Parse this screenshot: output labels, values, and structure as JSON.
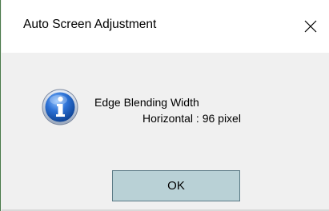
{
  "window": {
    "title": "Auto Screen Adjustment",
    "close_icon": "close-icon"
  },
  "message": {
    "icon": "info-icon",
    "line1": "Edge Blending Width",
    "line2": "Horizontal : 96 pixel"
  },
  "buttons": {
    "ok_label": "OK"
  },
  "colors": {
    "titlebar": "#ffffff",
    "client_bg": "#f0f0f0",
    "ok_button_bg": "#b9d1d6",
    "ok_button_border": "#5a7a85",
    "info_icon_blue": "#1f5fbf"
  }
}
